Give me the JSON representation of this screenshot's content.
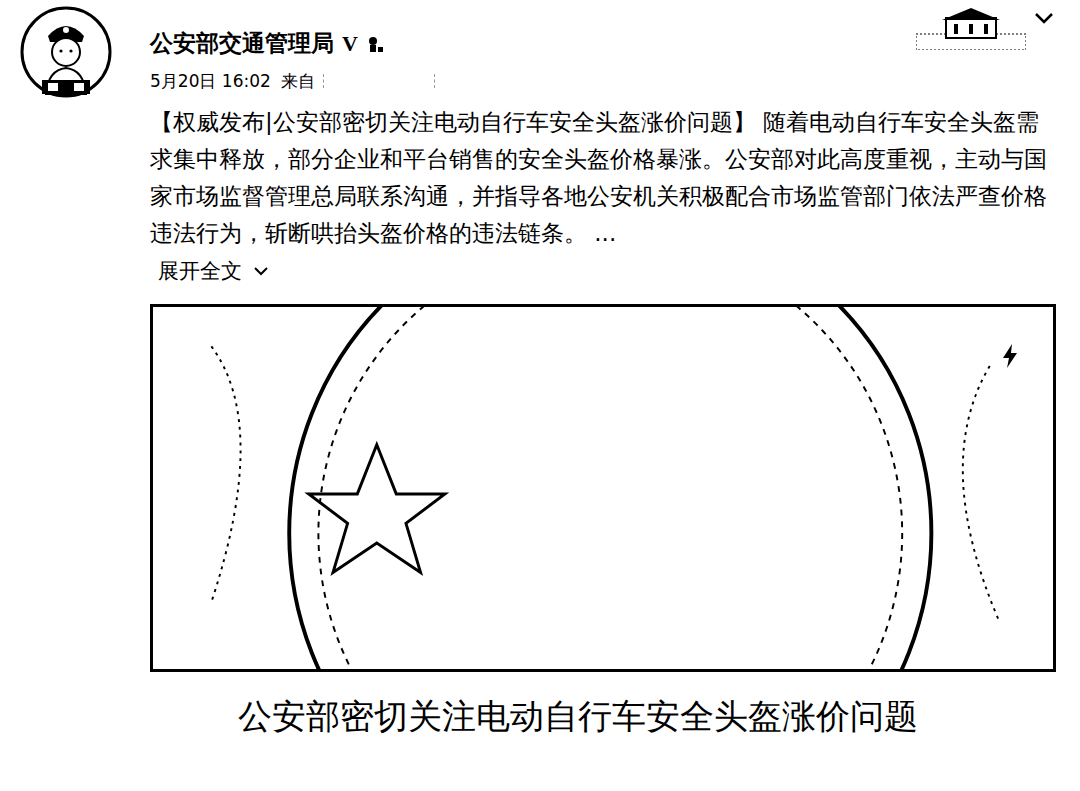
{
  "post": {
    "author": "公安部交通管理局",
    "verified_badge": "V",
    "time": "5月20日 16:02",
    "source_prefix": "来自",
    "text": "【权威发布|公安部密切关注电动自行车安全头盔涨价问题】 随着电动自行车安全头盔需求集中释放，部分企业和平台销售的安全头盔价格暴涨。公安部对此高度重视，主动与国家市场监督管理总局联系沟通，并指导各地公安机关积极配合市场监管部门依法严查价格违法行为，斩断哄抬头盔价格的违法链条。  ...",
    "expand_label": "展开全文",
    "media_caption": "公安部密切关注电动自行车安全头盔涨价问题"
  }
}
